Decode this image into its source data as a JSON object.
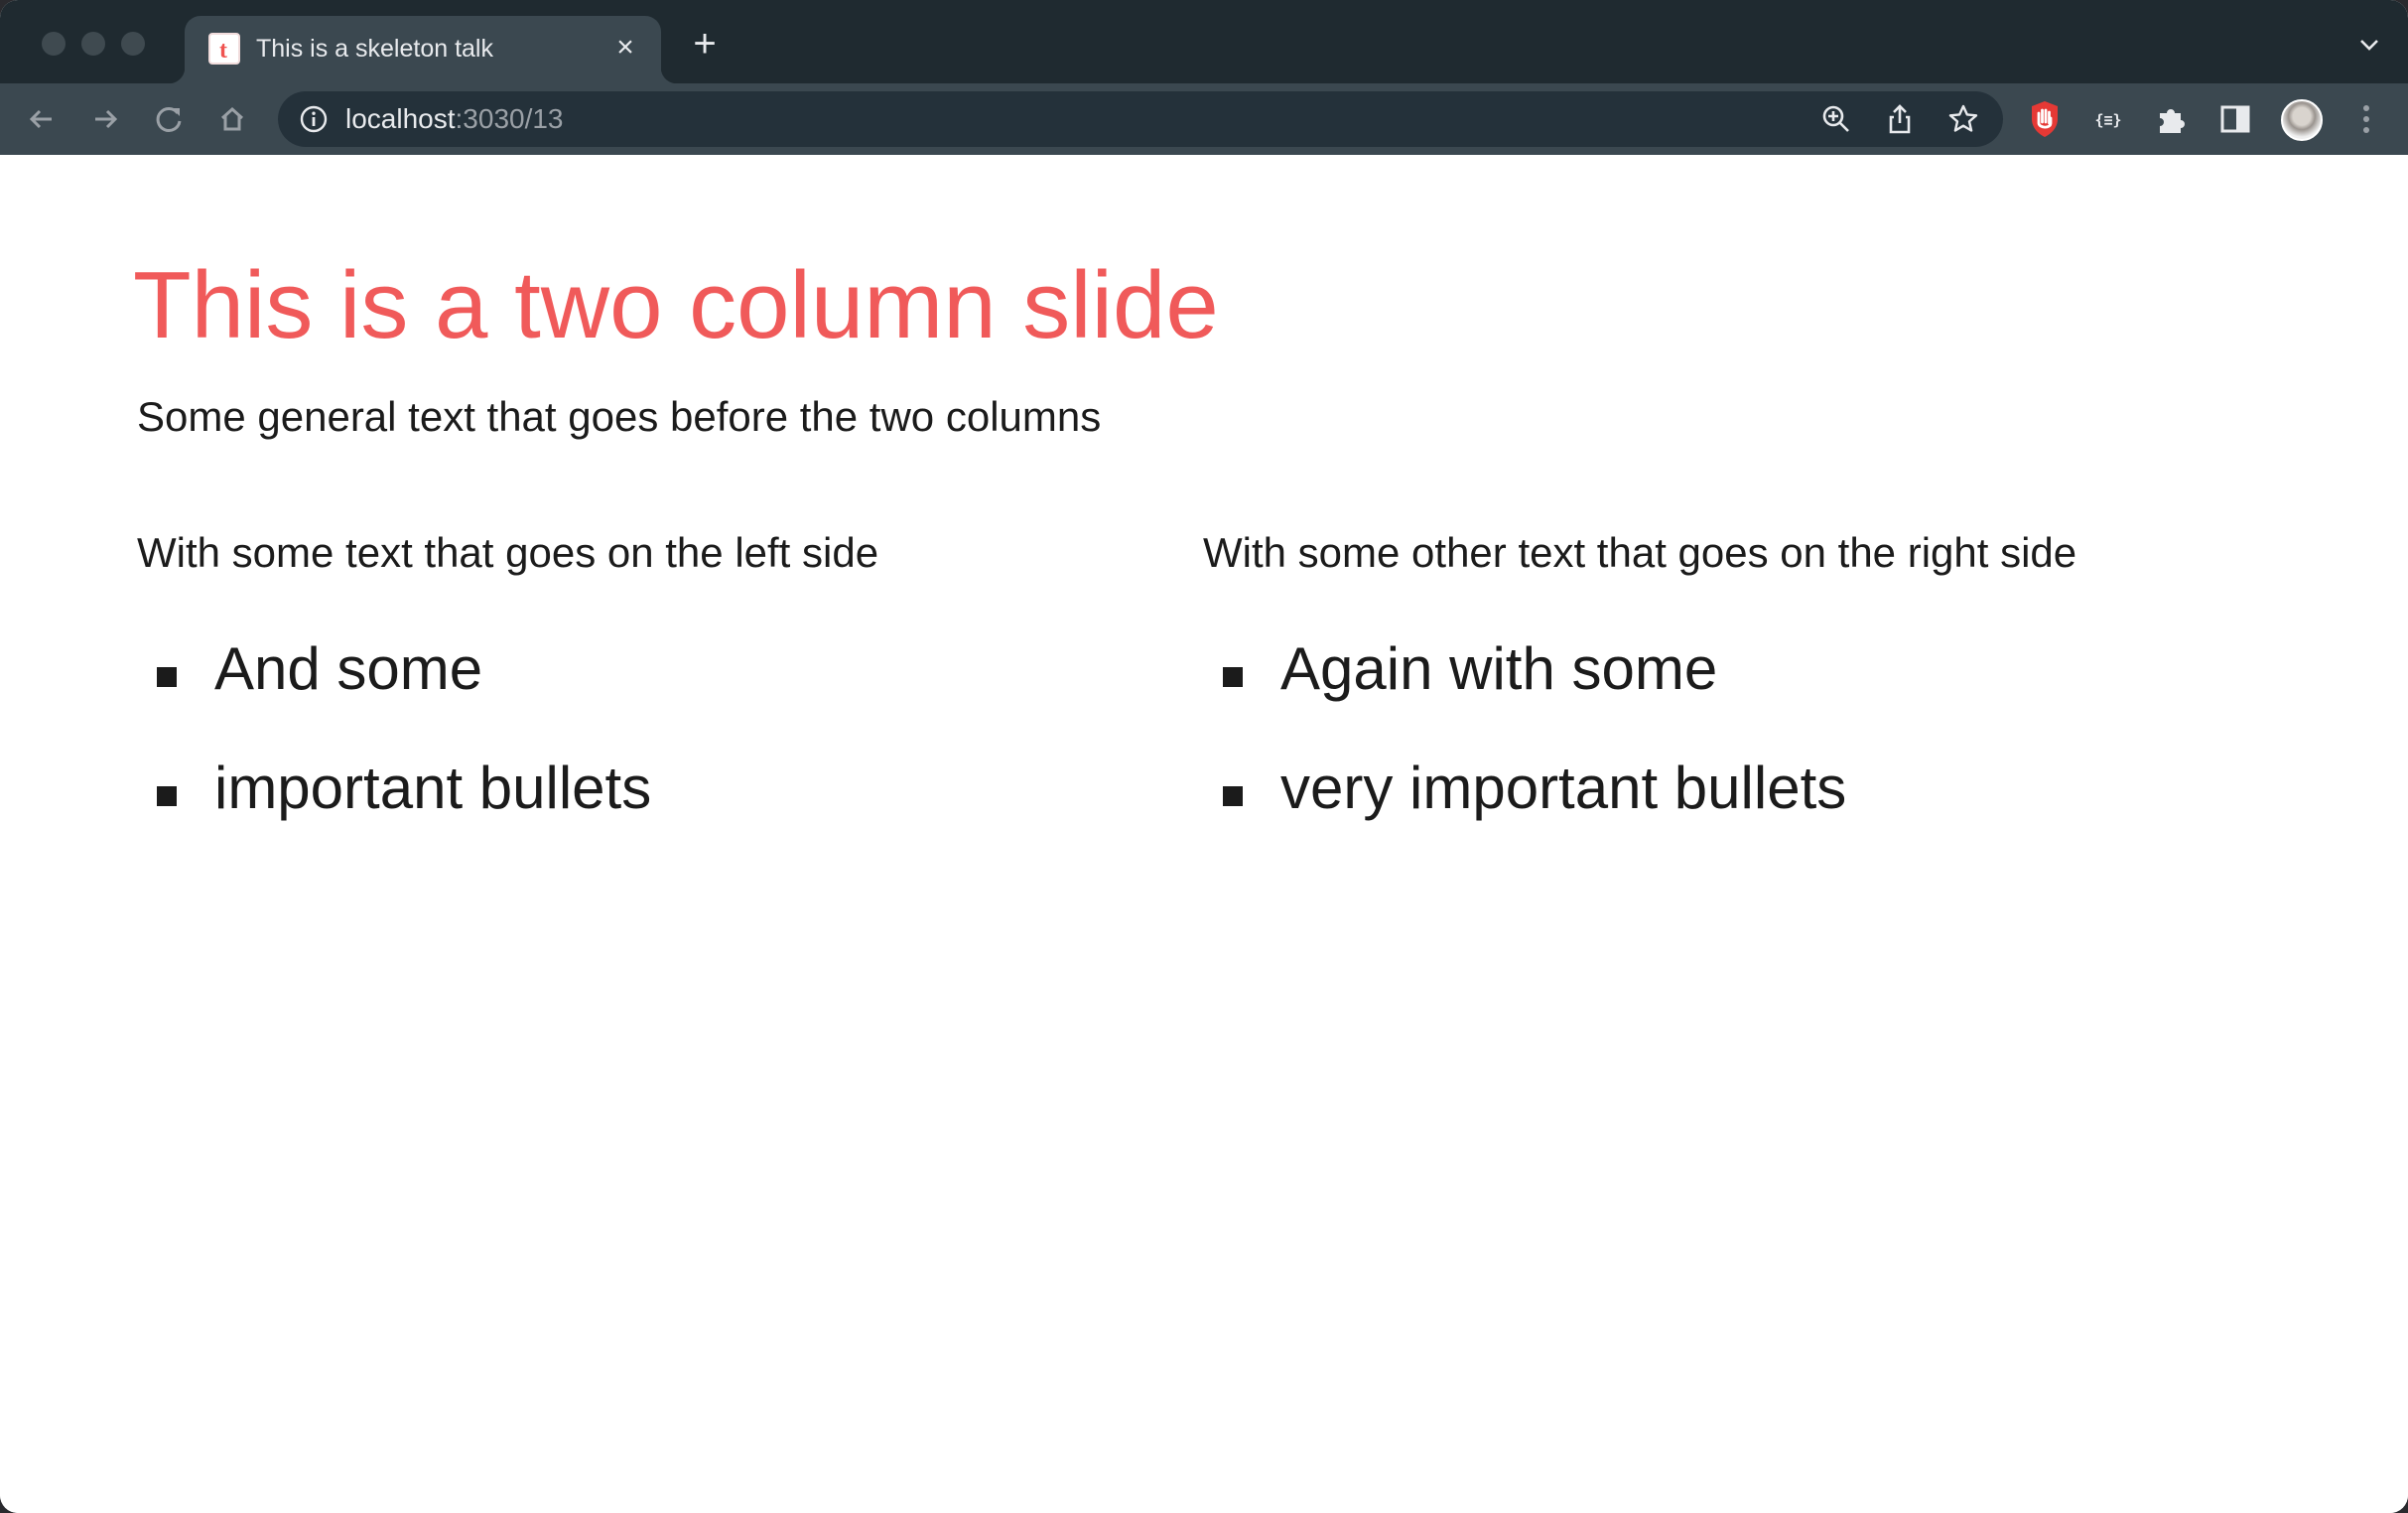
{
  "browser": {
    "tab": {
      "title": "This is a skeleton talk",
      "favicon_letter": "t"
    },
    "address": {
      "host": "localhost",
      "path": ":3030/13"
    }
  },
  "slide": {
    "title": "This is a two column slide",
    "intro": "Some general text that goes before the two columns",
    "left": {
      "text": "With some text that goes on the left side",
      "bullets": [
        "And some",
        "important bullets"
      ]
    },
    "right": {
      "text": "With some other text that goes on the right side",
      "bullets": [
        "Again with some",
        "very important bullets"
      ]
    }
  },
  "colors": {
    "accent": "#f05a5a",
    "chrome_dark": "#1f2a30",
    "chrome_toolbar": "#3b4850",
    "text": "#1b1b1b"
  },
  "icons": [
    "back-arrow-icon",
    "forward-arrow-icon",
    "reload-icon",
    "home-icon",
    "info-icon",
    "zoom-icon",
    "share-icon",
    "bookmark-star-icon",
    "adblock-hand-icon",
    "json-viewer-icon",
    "extensions-puzzle-icon",
    "side-panel-icon",
    "menu-dots-icon"
  ]
}
